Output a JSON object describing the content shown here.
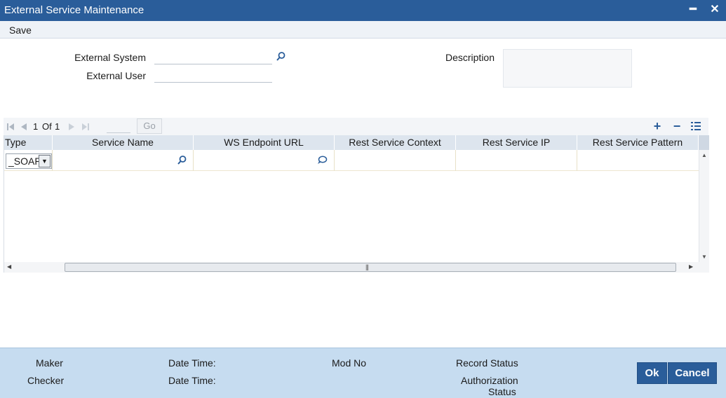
{
  "window": {
    "title": "External Service Maintenance",
    "minimize_symbol": "━",
    "close_symbol": "✕"
  },
  "menu": {
    "save_label": "Save"
  },
  "form": {
    "external_system_label": "External System",
    "external_system_value": "",
    "external_user_label": "External User",
    "external_user_value": "",
    "description_label": "Description",
    "description_value": ""
  },
  "pager": {
    "current_page": "1",
    "of_label": "Of",
    "total_pages": "1",
    "page_input_value": "",
    "go_label": "Go"
  },
  "grid": {
    "add_symbol": "+",
    "delete_symbol": "−",
    "columns": [
      "Type",
      "Service Name",
      "WS Endpoint URL",
      "Rest Service Context",
      "Rest Service IP",
      "Rest Service Pattern"
    ],
    "rows": [
      {
        "type": "_SOAP",
        "service_name": "",
        "ws_endpoint_url": "",
        "rest_service_context": "",
        "rest_service_ip": "",
        "rest_service_pattern": ""
      }
    ]
  },
  "footer": {
    "maker_label": "Maker",
    "checker_label": "Checker",
    "date_time_label_1": "Date Time:",
    "date_time_label_2": "Date Time:",
    "mod_no_label": "Mod No",
    "record_status_label": "Record Status",
    "authorization_status_label_line1": "Authorization",
    "authorization_status_label_line2": "Status",
    "ok_label": "Ok",
    "cancel_label": "Cancel"
  },
  "colors": {
    "titlebar": "#2a5d9a",
    "footer": "#c6dcf0",
    "grid_header": "#dde5ee",
    "button": "#2a5d9a"
  },
  "icons": [
    "search-icon",
    "comment-icon",
    "first-page-icon",
    "prev-page-icon",
    "next-page-icon",
    "last-page-icon",
    "add-row-icon",
    "delete-row-icon",
    "single-view-icon",
    "dropdown-arrow-icon"
  ]
}
